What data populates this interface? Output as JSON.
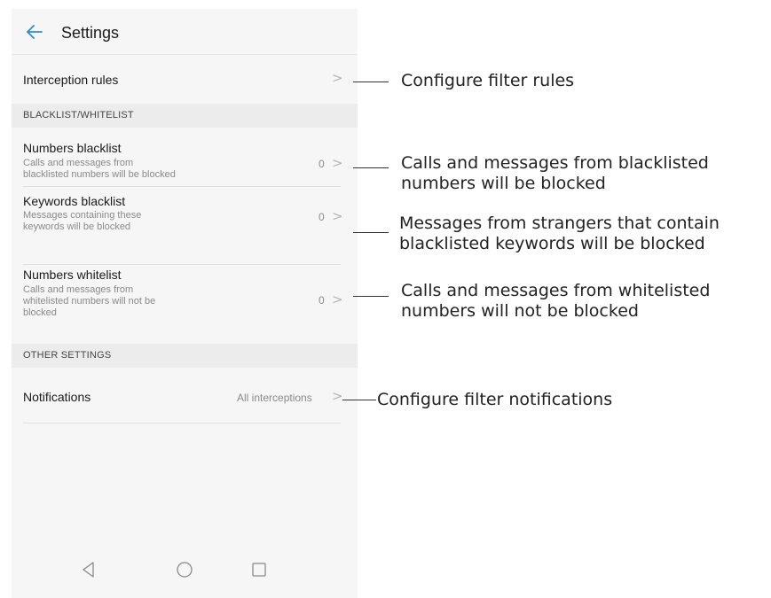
{
  "appbar": {
    "title": "Settings",
    "back_icon": "back-arrow-icon",
    "accent": "#2a8ddb"
  },
  "rows": {
    "interception": {
      "title": "Interception rules",
      "chevron": ">"
    },
    "section1": {
      "label": "BLACKLIST/WHITELIST"
    },
    "numbers_blacklist": {
      "title": "Numbers blacklist",
      "subtitle": "Calls and messages from\nblacklisted numbers will be blocked",
      "value": "0",
      "chevron": ">"
    },
    "keywords_blacklist": {
      "title": "Keywords blacklist",
      "subtitle": "Messages containing these\nkeywords will be blocked",
      "value": "0",
      "chevron": ">"
    },
    "numbers_whitelist": {
      "title": "Numbers whitelist",
      "subtitle": "Calls and messages from\nwhitelisted numbers will not be\nblocked",
      "value": "0",
      "chevron": ">"
    },
    "section2": {
      "label": "OTHER SETTINGS"
    },
    "notifications": {
      "title": "Notifications",
      "value": "All interceptions",
      "chevron": ">"
    }
  },
  "navbar": {
    "icons": [
      "back-triangle-icon",
      "home-circle-icon",
      "recents-square-icon"
    ]
  },
  "callouts": {
    "interception": "Configure filter rules",
    "numbers_blacklist": "Calls and messages from blacklisted\nnumbers will be blocked",
    "keywords_blacklist": "Messages from strangers that contain\nblacklisted keywords will be blocked",
    "numbers_whitelist": "Calls and messages from whitelisted\nnumbers will not be blocked",
    "notifications": "Configure filter notifications"
  }
}
